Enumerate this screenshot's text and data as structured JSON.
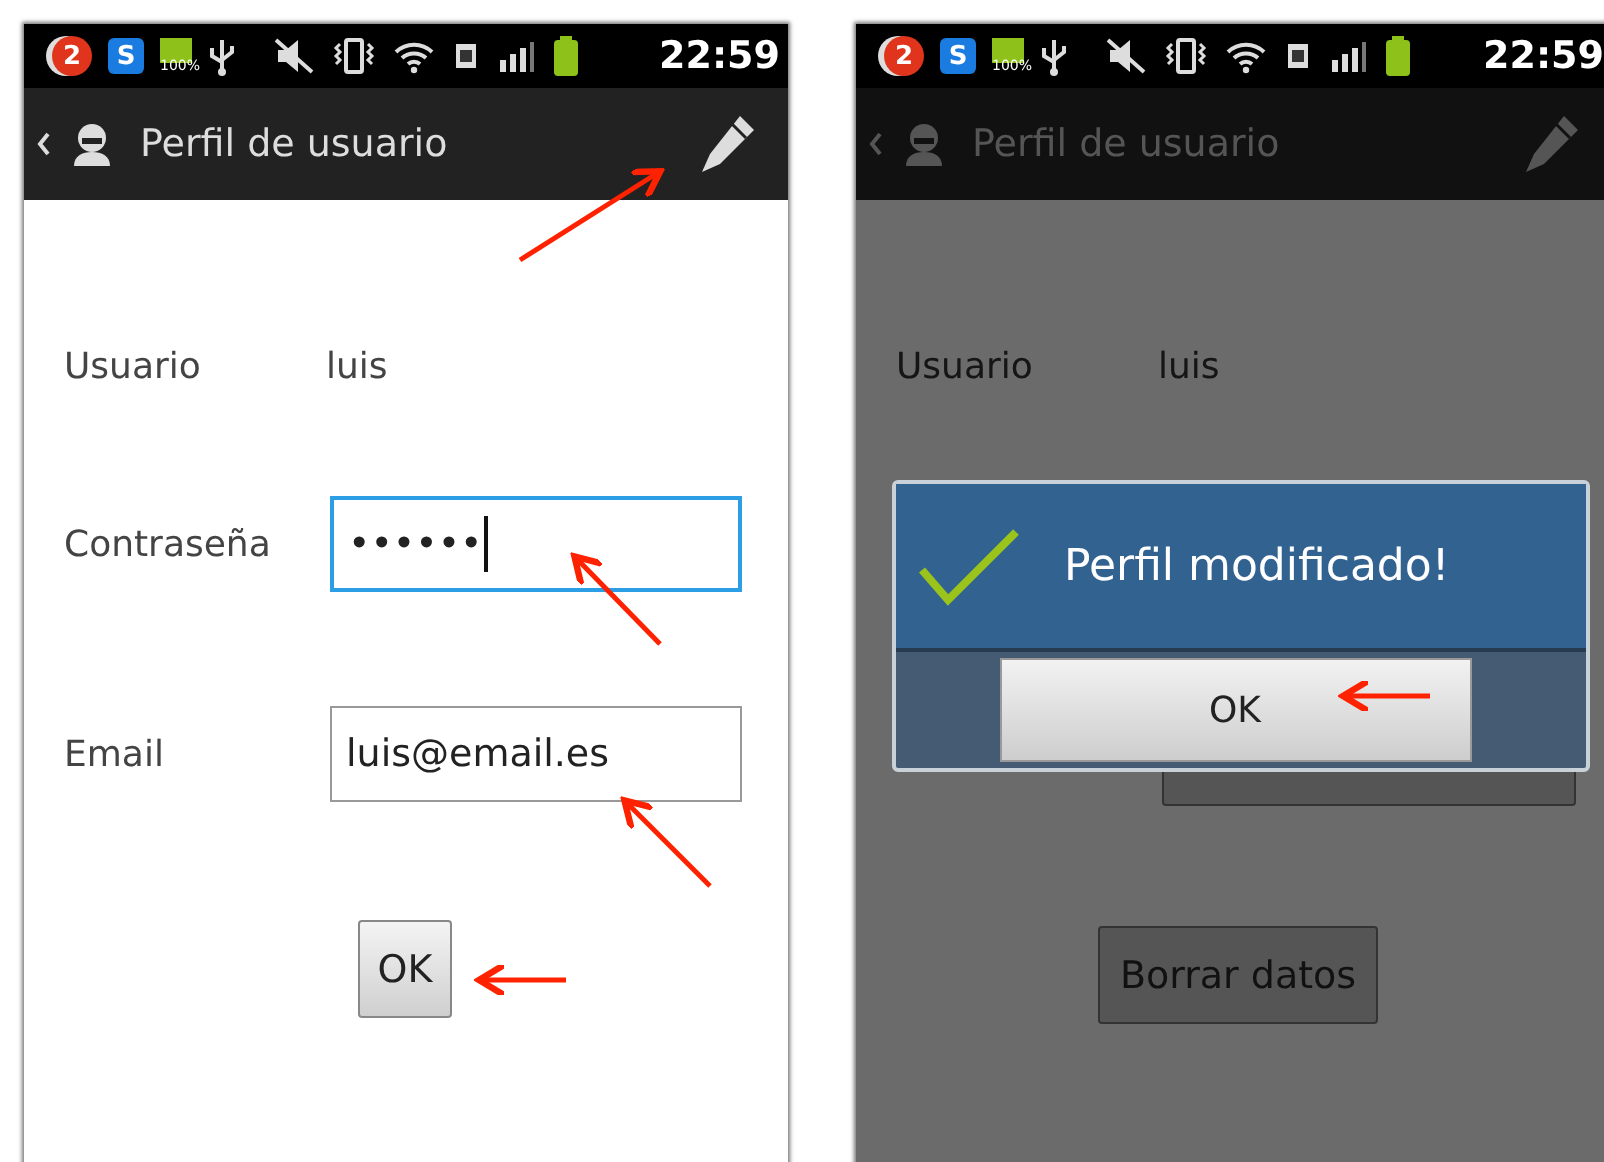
{
  "screens": [
    {
      "status_bar": {
        "notification_count": "2",
        "app_letter": "S",
        "battery_percent": "100%",
        "time": "22:59"
      },
      "action_bar": {
        "title": "Perfil de usuario"
      },
      "dimmed": false,
      "fields": [
        {
          "kind": "text",
          "label": "Usuario",
          "value": "luis"
        },
        {
          "kind": "input",
          "label": "Contraseña",
          "value": "••••••",
          "focused": true
        },
        {
          "kind": "input",
          "label": "Email",
          "value": "luis@email.es",
          "focused": false
        }
      ],
      "buttons": [
        {
          "kind": "small",
          "label": "OK"
        }
      ]
    },
    {
      "status_bar": {
        "notification_count": "2",
        "app_letter": "S",
        "battery_percent": "100%",
        "time": "22:59"
      },
      "action_bar": {
        "title": "Perfil de usuario"
      },
      "dimmed": true,
      "fields": [
        {
          "kind": "text",
          "label": "Usuario",
          "value": "luis"
        }
      ],
      "buttons": [
        {
          "kind": "covered"
        },
        {
          "kind": "wide",
          "label": "Borrar datos"
        }
      ],
      "dialog": {
        "message": "Perfil modificado!",
        "button": "OK"
      }
    }
  ]
}
